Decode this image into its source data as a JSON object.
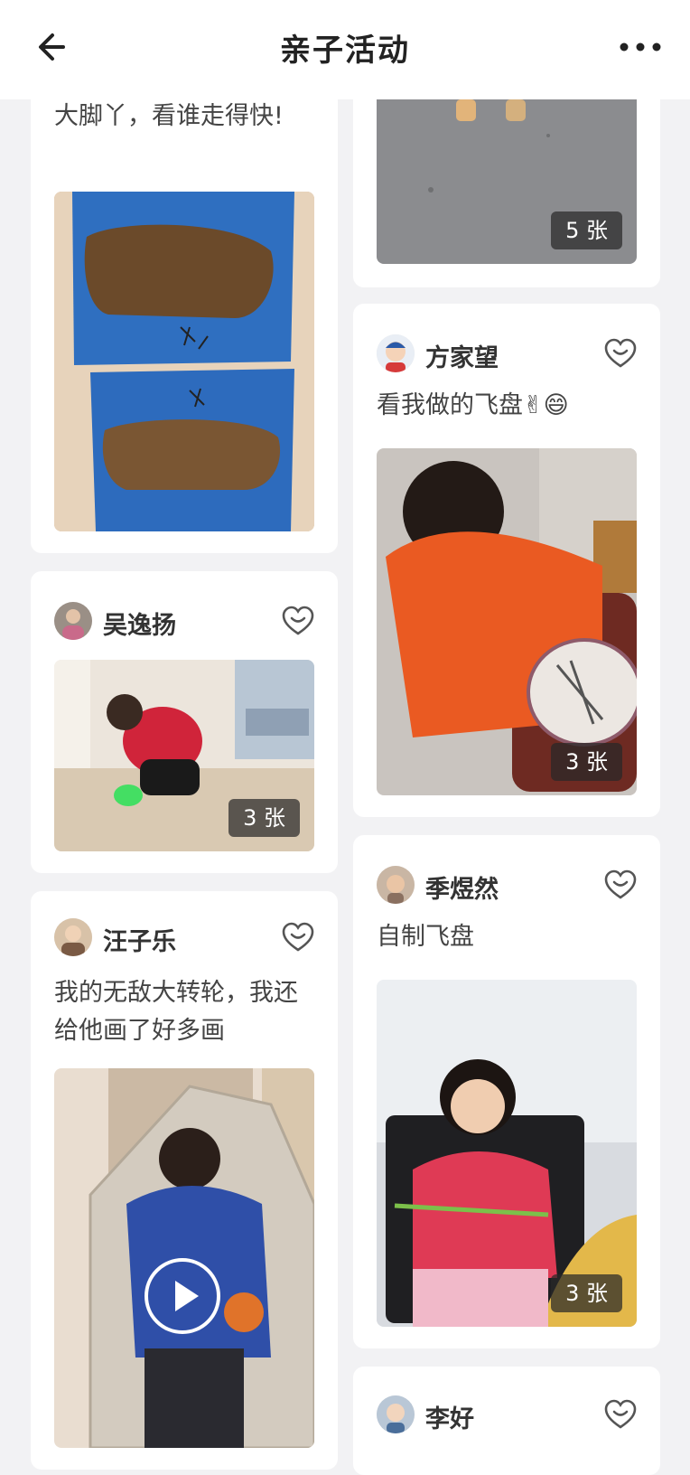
{
  "header": {
    "title": "亲子活动",
    "back_icon": "arrow-left-icon",
    "more_icon": "more-dots-icon"
  },
  "feed": {
    "left": [
      {
        "text": "大脚丫，看谁走得快!"
      },
      {
        "user": "吴逸扬",
        "count": "3 张"
      },
      {
        "user": "汪子乐",
        "text": "我的无敌大转轮，我还给他画了好多画",
        "media": "video"
      }
    ],
    "right": [
      {
        "count": "5 张"
      },
      {
        "user": "方家望",
        "text": "看我做的飞盘✌😄",
        "count": "3 张"
      },
      {
        "user": "季煜然",
        "text": "自制飞盘",
        "count": "3 张"
      },
      {
        "user": "李好"
      }
    ]
  },
  "colors": {
    "background": "#f2f2f4",
    "card": "#ffffff",
    "badge": "#2a2a2a"
  }
}
